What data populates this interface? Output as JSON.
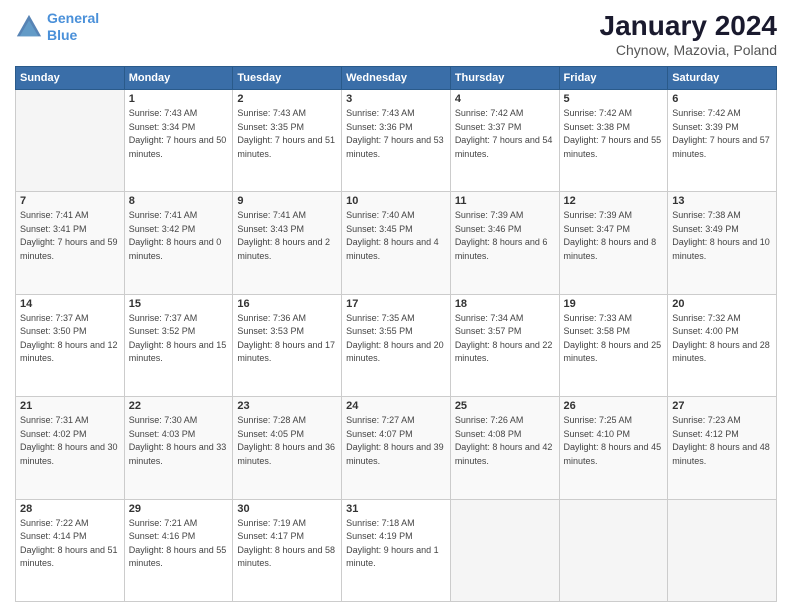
{
  "logo": {
    "line1": "General",
    "line2": "Blue"
  },
  "title": "January 2024",
  "subtitle": "Chynow, Mazovia, Poland",
  "days_of_week": [
    "Sunday",
    "Monday",
    "Tuesday",
    "Wednesday",
    "Thursday",
    "Friday",
    "Saturday"
  ],
  "weeks": [
    [
      {
        "day": "",
        "info": ""
      },
      {
        "day": "1",
        "sunrise": "Sunrise: 7:43 AM",
        "sunset": "Sunset: 3:34 PM",
        "daylight": "Daylight: 7 hours and 50 minutes."
      },
      {
        "day": "2",
        "sunrise": "Sunrise: 7:43 AM",
        "sunset": "Sunset: 3:35 PM",
        "daylight": "Daylight: 7 hours and 51 minutes."
      },
      {
        "day": "3",
        "sunrise": "Sunrise: 7:43 AM",
        "sunset": "Sunset: 3:36 PM",
        "daylight": "Daylight: 7 hours and 53 minutes."
      },
      {
        "day": "4",
        "sunrise": "Sunrise: 7:42 AM",
        "sunset": "Sunset: 3:37 PM",
        "daylight": "Daylight: 7 hours and 54 minutes."
      },
      {
        "day": "5",
        "sunrise": "Sunrise: 7:42 AM",
        "sunset": "Sunset: 3:38 PM",
        "daylight": "Daylight: 7 hours and 55 minutes."
      },
      {
        "day": "6",
        "sunrise": "Sunrise: 7:42 AM",
        "sunset": "Sunset: 3:39 PM",
        "daylight": "Daylight: 7 hours and 57 minutes."
      }
    ],
    [
      {
        "day": "7",
        "sunrise": "Sunrise: 7:41 AM",
        "sunset": "Sunset: 3:41 PM",
        "daylight": "Daylight: 7 hours and 59 minutes."
      },
      {
        "day": "8",
        "sunrise": "Sunrise: 7:41 AM",
        "sunset": "Sunset: 3:42 PM",
        "daylight": "Daylight: 8 hours and 0 minutes."
      },
      {
        "day": "9",
        "sunrise": "Sunrise: 7:41 AM",
        "sunset": "Sunset: 3:43 PM",
        "daylight": "Daylight: 8 hours and 2 minutes."
      },
      {
        "day": "10",
        "sunrise": "Sunrise: 7:40 AM",
        "sunset": "Sunset: 3:45 PM",
        "daylight": "Daylight: 8 hours and 4 minutes."
      },
      {
        "day": "11",
        "sunrise": "Sunrise: 7:39 AM",
        "sunset": "Sunset: 3:46 PM",
        "daylight": "Daylight: 8 hours and 6 minutes."
      },
      {
        "day": "12",
        "sunrise": "Sunrise: 7:39 AM",
        "sunset": "Sunset: 3:47 PM",
        "daylight": "Daylight: 8 hours and 8 minutes."
      },
      {
        "day": "13",
        "sunrise": "Sunrise: 7:38 AM",
        "sunset": "Sunset: 3:49 PM",
        "daylight": "Daylight: 8 hours and 10 minutes."
      }
    ],
    [
      {
        "day": "14",
        "sunrise": "Sunrise: 7:37 AM",
        "sunset": "Sunset: 3:50 PM",
        "daylight": "Daylight: 8 hours and 12 minutes."
      },
      {
        "day": "15",
        "sunrise": "Sunrise: 7:37 AM",
        "sunset": "Sunset: 3:52 PM",
        "daylight": "Daylight: 8 hours and 15 minutes."
      },
      {
        "day": "16",
        "sunrise": "Sunrise: 7:36 AM",
        "sunset": "Sunset: 3:53 PM",
        "daylight": "Daylight: 8 hours and 17 minutes."
      },
      {
        "day": "17",
        "sunrise": "Sunrise: 7:35 AM",
        "sunset": "Sunset: 3:55 PM",
        "daylight": "Daylight: 8 hours and 20 minutes."
      },
      {
        "day": "18",
        "sunrise": "Sunrise: 7:34 AM",
        "sunset": "Sunset: 3:57 PM",
        "daylight": "Daylight: 8 hours and 22 minutes."
      },
      {
        "day": "19",
        "sunrise": "Sunrise: 7:33 AM",
        "sunset": "Sunset: 3:58 PM",
        "daylight": "Daylight: 8 hours and 25 minutes."
      },
      {
        "day": "20",
        "sunrise": "Sunrise: 7:32 AM",
        "sunset": "Sunset: 4:00 PM",
        "daylight": "Daylight: 8 hours and 28 minutes."
      }
    ],
    [
      {
        "day": "21",
        "sunrise": "Sunrise: 7:31 AM",
        "sunset": "Sunset: 4:02 PM",
        "daylight": "Daylight: 8 hours and 30 minutes."
      },
      {
        "day": "22",
        "sunrise": "Sunrise: 7:30 AM",
        "sunset": "Sunset: 4:03 PM",
        "daylight": "Daylight: 8 hours and 33 minutes."
      },
      {
        "day": "23",
        "sunrise": "Sunrise: 7:28 AM",
        "sunset": "Sunset: 4:05 PM",
        "daylight": "Daylight: 8 hours and 36 minutes."
      },
      {
        "day": "24",
        "sunrise": "Sunrise: 7:27 AM",
        "sunset": "Sunset: 4:07 PM",
        "daylight": "Daylight: 8 hours and 39 minutes."
      },
      {
        "day": "25",
        "sunrise": "Sunrise: 7:26 AM",
        "sunset": "Sunset: 4:08 PM",
        "daylight": "Daylight: 8 hours and 42 minutes."
      },
      {
        "day": "26",
        "sunrise": "Sunrise: 7:25 AM",
        "sunset": "Sunset: 4:10 PM",
        "daylight": "Daylight: 8 hours and 45 minutes."
      },
      {
        "day": "27",
        "sunrise": "Sunrise: 7:23 AM",
        "sunset": "Sunset: 4:12 PM",
        "daylight": "Daylight: 8 hours and 48 minutes."
      }
    ],
    [
      {
        "day": "28",
        "sunrise": "Sunrise: 7:22 AM",
        "sunset": "Sunset: 4:14 PM",
        "daylight": "Daylight: 8 hours and 51 minutes."
      },
      {
        "day": "29",
        "sunrise": "Sunrise: 7:21 AM",
        "sunset": "Sunset: 4:16 PM",
        "daylight": "Daylight: 8 hours and 55 minutes."
      },
      {
        "day": "30",
        "sunrise": "Sunrise: 7:19 AM",
        "sunset": "Sunset: 4:17 PM",
        "daylight": "Daylight: 8 hours and 58 minutes."
      },
      {
        "day": "31",
        "sunrise": "Sunrise: 7:18 AM",
        "sunset": "Sunset: 4:19 PM",
        "daylight": "Daylight: 9 hours and 1 minute."
      },
      {
        "day": "",
        "info": ""
      },
      {
        "day": "",
        "info": ""
      },
      {
        "day": "",
        "info": ""
      }
    ]
  ]
}
